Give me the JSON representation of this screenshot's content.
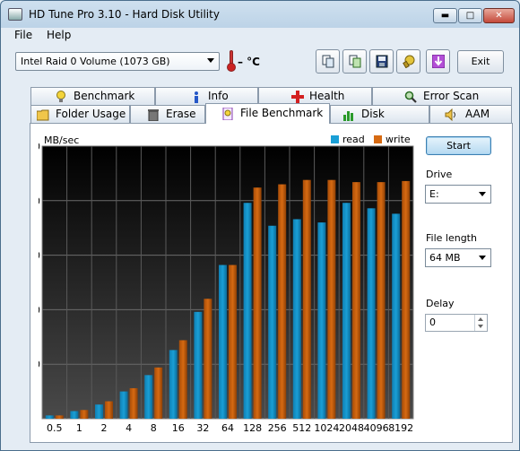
{
  "window": {
    "title": "HD Tune Pro 3.10 - Hard Disk Utility"
  },
  "menu": {
    "file": "File",
    "help": "Help"
  },
  "toolbar": {
    "drive": "Intel   Raid 0 Volume (1073 GB)",
    "temperature": "– °C",
    "exit_label": "Exit"
  },
  "tabs_top": [
    "Benchmark",
    "Info",
    "Health",
    "Error Scan"
  ],
  "tabs_bottom": [
    "Folder Usage",
    "Erase",
    "File Benchmark",
    "Disk monitor",
    "AAM"
  ],
  "active_tab": "File Benchmark",
  "controls": {
    "start_label": "Start",
    "drive_label": "Drive",
    "drive_value": "E:",
    "file_length_label": "File length",
    "file_length_value": "64 MB",
    "delay_label": "Delay",
    "delay_value": "0"
  },
  "colors": {
    "read": "#1a9fd6",
    "write": "#d66a12",
    "plot_bg": "#101010"
  },
  "chart_data": {
    "type": "bar",
    "ylabel": "MB/sec",
    "ylim": [
      0,
      250
    ],
    "yticks": [
      50,
      100,
      150,
      200,
      250
    ],
    "categories": [
      "0.5",
      "1",
      "2",
      "4",
      "8",
      "16",
      "32",
      "64",
      "128",
      "256",
      "512",
      "1024",
      "2048",
      "4096",
      "8192"
    ],
    "series": [
      {
        "name": "read",
        "values": [
          3,
          7,
          13,
          25,
          40,
          63,
          98,
          141,
          198,
          177,
          183,
          180,
          198,
          193,
          188
        ]
      },
      {
        "name": "write",
        "values": [
          3,
          8,
          16,
          28,
          47,
          72,
          110,
          141,
          212,
          215,
          219,
          219,
          217,
          217,
          218
        ]
      }
    ]
  }
}
